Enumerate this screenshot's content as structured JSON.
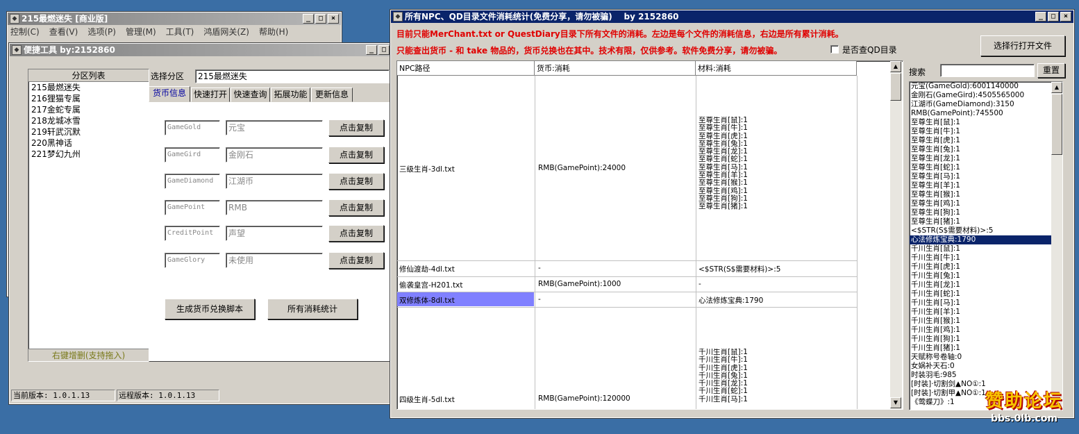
{
  "main_window": {
    "title": "215最燃迷失 [商业版]",
    "menu": [
      "控制(C)",
      "查看(V)",
      "选项(P)",
      "管理(M)",
      "工具(T)",
      "鸿盾网关(Z)",
      "帮助(H)"
    ]
  },
  "tool_window": {
    "title": "便捷工具  by:2152860",
    "partition_list_header": "分区列表",
    "partitions": [
      "215最燃迷失",
      "216狸猫专属",
      "217金蛇专属",
      "218龙城冰雪",
      "219轩武沉默",
      "220黑神话",
      "221梦幻九州"
    ],
    "partition_footer": "右键增删(支持拖入)",
    "select_label": "选择分区",
    "select_value": "215最燃迷失",
    "tabs": [
      "货币信息",
      "快速打开",
      "快速查询",
      "拓展功能",
      "更新信息"
    ],
    "currency_rows": [
      {
        "key": "GameGold",
        "name": "元宝",
        "button": "点击复制"
      },
      {
        "key": "GameGird",
        "name": "金刚石",
        "button": "点击复制"
      },
      {
        "key": "GameDiamond",
        "name": "江湖币",
        "button": "点击复制"
      },
      {
        "key": "GamePoint",
        "name": "RMB",
        "button": "点击复制"
      },
      {
        "key": "CreditPoint",
        "name": "声望",
        "button": "点击复制"
      },
      {
        "key": "GameGlory",
        "name": "未使用",
        "button": "点击复制"
      }
    ],
    "gen_script_button": "生成货币兑换脚本",
    "all_stats_button": "所有消耗统计",
    "status_current": "当前版本: 1.0.1.13",
    "status_remote": "远程版本: 1.0.1.13"
  },
  "stats_window": {
    "title": "所有NPC、QD目录文件消耗统计(免费分享，请勿被骗)    by 2152860",
    "notice_line1": "目前只能MerChant.txt or QuestDiary目录下所有文件的消耗。左边是每个文件的消耗信息，右边是所有累计消耗。",
    "notice_line2": "只能查出货币 - 和 take 物品的，货币兑换也在其中。技术有限，仅供参考。软件免费分享，请勿被骗。",
    "qd_checkbox_label": "是否查QD目录",
    "open_file_button": "选择行打开文件",
    "columns": [
      "NPC路径",
      "货币:消耗",
      "材料:消耗"
    ],
    "rows": [
      {
        "path": "三级生肖-3dl.txt",
        "currency": "RMB(GamePoint):24000",
        "materials": "至尊生肖[鼠]:1\n至尊生肖[牛]:1\n至尊生肖[虎]:1\n至尊生肖[兔]:1\n至尊生肖[龙]:1\n至尊生肖[蛇]:1\n至尊生肖[马]:1\n至尊生肖[羊]:1\n至尊生肖[猴]:1\n至尊生肖[鸡]:1\n至尊生肖[狗]:1\n至尊生肖[猪]:1"
      },
      {
        "path": "修仙渡劫-4dl.txt",
        "currency": "-",
        "materials": "<$STR(S$需要材料)>:5"
      },
      {
        "path": "偷袭皇宫-H201.txt",
        "currency": "RMB(GamePoint):1000",
        "materials": "-"
      },
      {
        "path": "双修炼体-8dl.txt",
        "currency": "-",
        "materials": "心法修炼宝典:1790"
      },
      {
        "path": "四级生肖-5dl.txt",
        "currency": "RMB(GamePoint):120000",
        "materials": "千川生肖[鼠]:1\n千川生肖[牛]:1\n千川生肖[虎]:1\n千川生肖[兔]:1\n千川生肖[龙]:1\n千川生肖[蛇]:1\n千川生肖[马]:1"
      }
    ],
    "search_label": "搜索",
    "search_value": "",
    "reset_button": "重置",
    "totals": [
      "元宝(GameGold):6001140000",
      "金刚石(GameGird):4505565000",
      "江湖币(GameDiamond):3150",
      "RMB(GamePoint):745500",
      "至尊生肖[鼠]:1",
      "至尊生肖[牛]:1",
      "至尊生肖[虎]:1",
      "至尊生肖[兔]:1",
      "至尊生肖[龙]:1",
      "至尊生肖[蛇]:1",
      "至尊生肖[马]:1",
      "至尊生肖[羊]:1",
      "至尊生肖[猴]:1",
      "至尊生肖[鸡]:1",
      "至尊生肖[狗]:1",
      "至尊生肖[猪]:1",
      "<$STR(S$需要材料)>:5",
      "心法修炼宝典:1790",
      "千川生肖[鼠]:1",
      "千川生肖[牛]:1",
      "千川生肖[虎]:1",
      "千川生肖[兔]:1",
      "千川生肖[龙]:1",
      "千川生肖[蛇]:1",
      "千川生肖[马]:1",
      "千川生肖[羊]:1",
      "千川生肖[猴]:1",
      "千川生肖[鸡]:1",
      "千川生肖[狗]:1",
      "千川生肖[猪]:1",
      "天赋称号卷轴:0",
      "女娲补天石:0",
      "时装羽毛:985",
      "[时装]·切割剑▲NO①:1",
      "[时装]·切割甲▲NO①:1",
      "《莺蝶刀》:1"
    ],
    "selected_total": "心法修炼宝典:1790"
  },
  "watermark": {
    "line1": "赞助论坛",
    "line2": "bbs.0lb.com"
  }
}
